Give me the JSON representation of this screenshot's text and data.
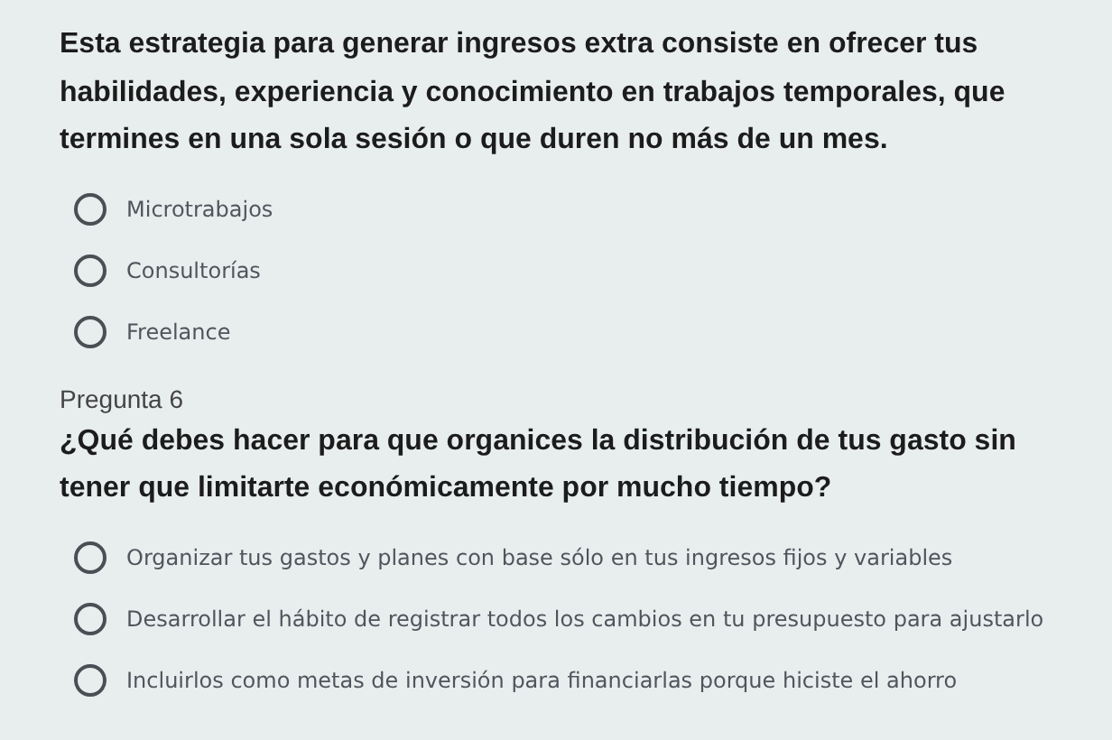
{
  "questions": [
    {
      "text": "Esta estrategia para generar ingresos extra consiste en ofrecer tus habilidades, experiencia y conocimiento en trabajos temporales, que termines en una sola sesión o que duren no más de un mes.",
      "options": [
        {
          "text": "Microtrabajos",
          "selected": false
        },
        {
          "text": "Consultorías",
          "selected": false
        },
        {
          "text": "Freelance",
          "selected": false
        }
      ]
    },
    {
      "label": "Pregunta 6",
      "text": "¿Qué debes hacer para que organices la distribución de tus gasto sin tener que limitarte económicamente por mucho tiempo?",
      "options": [
        {
          "text": "Organizar tus gastos y planes con base sólo en tus ingresos fijos y variables",
          "selected": false
        },
        {
          "text": "Desarrollar el hábito de registrar todos los cambios en tu presupuesto para ajustarlo",
          "selected": false
        },
        {
          "text": "Incluirlos como metas de inversión para financiarlas porque hiciste el ahorro",
          "selected": false
        }
      ]
    }
  ]
}
